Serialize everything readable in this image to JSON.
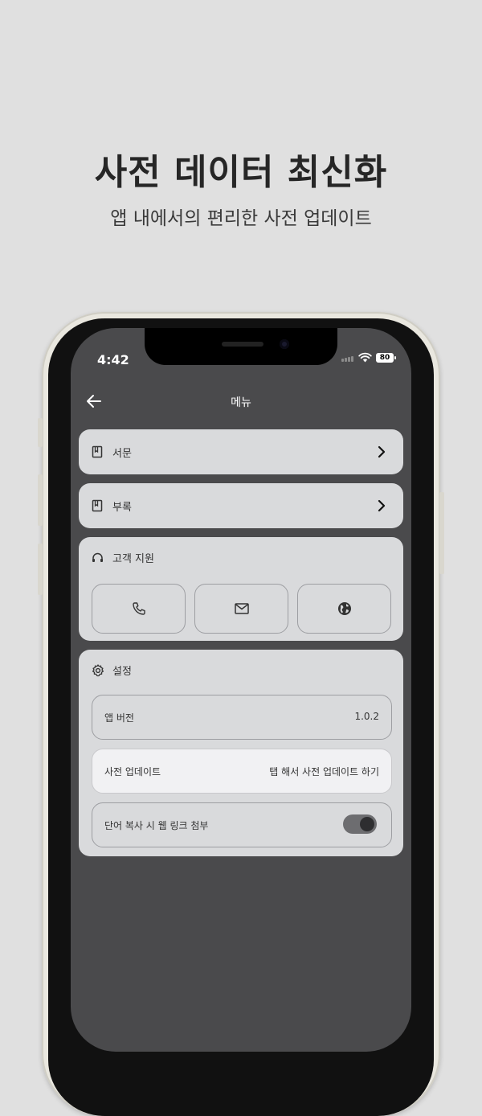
{
  "hero": {
    "title": "사전 데이터 최신화",
    "subtitle": "앱 내에서의 편리한 사전 업데이트"
  },
  "status_bar": {
    "time": "4:42",
    "battery": "80"
  },
  "nav": {
    "title": "메뉴",
    "back_icon": "arrow-left-icon"
  },
  "menu": {
    "preface": {
      "label": "서문",
      "icon": "book-icon"
    },
    "appendix": {
      "label": "부록",
      "icon": "book-icon"
    }
  },
  "support": {
    "title": "고객 지원",
    "icon": "headset-icon",
    "buttons": [
      {
        "icon": "phone-icon"
      },
      {
        "icon": "mail-icon"
      },
      {
        "icon": "globe-icon"
      }
    ]
  },
  "settings": {
    "title": "설정",
    "icon": "gear-icon",
    "app_version": {
      "label": "앱 버전",
      "value": "1.0.2"
    },
    "dict_update": {
      "label": "사전 업데이트",
      "value": "탭 해서 사전 업데이트 하기"
    },
    "web_link": {
      "label": "단어 복사 시 웹 링크 첨부",
      "enabled": true
    }
  },
  "colors": {
    "background": "#e0e0e0",
    "screen": "#4a4a4c",
    "card": "#d9dadc",
    "highlight": "#f1f1f3"
  }
}
